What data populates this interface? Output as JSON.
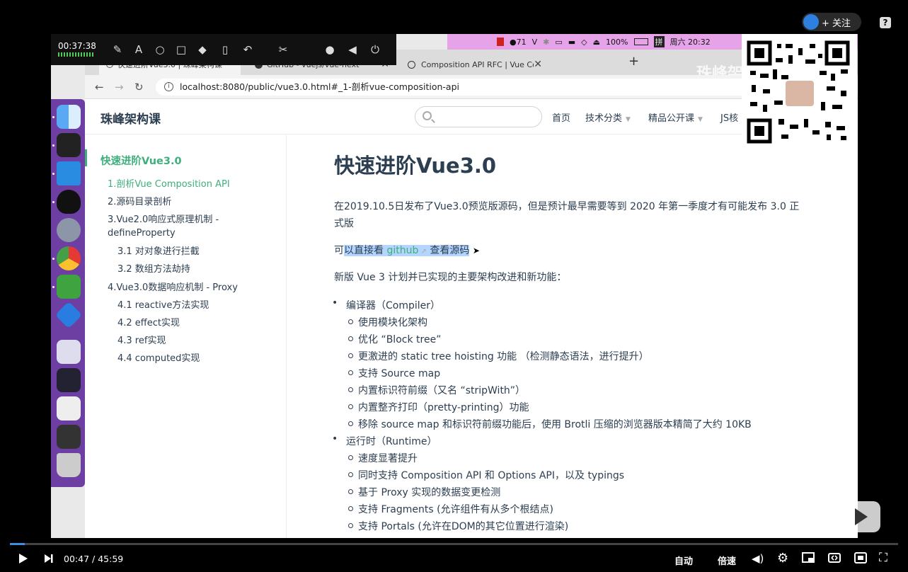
{
  "player": {
    "follow_label": "+ 关注",
    "help_label": "?",
    "time_current": "00:47",
    "time_sep": " / ",
    "time_total": "45:59",
    "progress": 0.017,
    "auto_label": "自动",
    "speed_label": "倍速"
  },
  "recorder": {
    "elapsed": "00:37:38"
  },
  "menubar": {
    "battery": "100%",
    "input_method": "拼",
    "clock": "周六 20:32",
    "badge_count": "71"
  },
  "browser": {
    "tabs": [
      {
        "label": "快速进阶Vue3.0 | 珠峰架构课"
      },
      {
        "label": "GitHub - vuejs/vue-next"
      },
      {
        "label": "Composition API RFC | Vue Co"
      }
    ],
    "url": "localhost:8080/public/vue3.0.html#_1-剖析vue-composition-api",
    "watermark": "珠峰架构"
  },
  "site": {
    "title": "珠峰架构课",
    "search_placeholder": "",
    "nav": [
      {
        "label": "首页"
      },
      {
        "label": "技术分类"
      },
      {
        "label": "精品公开课"
      },
      {
        "label": "JS核"
      }
    ]
  },
  "sidebar": {
    "heading": "快速进阶Vue3.0",
    "items": [
      {
        "label": "1.剖析Vue Composition API"
      },
      {
        "label": "2.源码目录剖析"
      },
      {
        "label": "3.Vue2.0响应式原理机制 -"
      },
      {
        "label": "defineProperty"
      },
      {
        "label": "3.1 对对象进行拦截"
      },
      {
        "label": "3.2 数组方法劫持"
      },
      {
        "label": "4.Vue3.0数据响应机制 - Proxy"
      },
      {
        "label": "4.1 reactive方法实现"
      },
      {
        "label": "4.2 effect实现"
      },
      {
        "label": "4.3 ref实现"
      },
      {
        "label": "4.4 computed实现"
      }
    ]
  },
  "doc": {
    "title": "快速进阶Vue3.0",
    "intro_line1": "在2019.10.5日发布了Vue3.0预览版源码，但是预计最早需要等到 2020 年第一季度才有可能发布 3.0 正",
    "intro_line2": "式版",
    "source_prefix": "可",
    "source_hl1": "以直接看 ",
    "source_link": "github",
    "source_hl2": " 查看源码",
    "features_intro": "新版 Vue 3 计划并已实现的主要架构改进和新功能：",
    "compiler": {
      "label": "编译器（Compiler）",
      "items": [
        "使用模块化架构",
        "优化 “Block tree”",
        "更激进的 static tree hoisting 功能 （检测静态语法，进行提升）",
        "支持 Source map",
        "内置标识符前缀（又名 “stripWith”）",
        "内置整齐打印（pretty-printing）功能",
        "移除 source map 和标识符前缀功能后，使用 Brotli 压缩的浏览器版本精简了大约 10KB"
      ]
    },
    "runtime": {
      "label": "运行时（Runtime）",
      "items": [
        "速度显著提升",
        "同时支持 Composition API 和 Options API，以及 typings",
        "基于 Proxy 实现的数据变更检测",
        "支持 Fragments (允许组件有从多个根结点)",
        "支持 Portals (允许在DOM的其它位置进行渲染)"
      ]
    }
  }
}
